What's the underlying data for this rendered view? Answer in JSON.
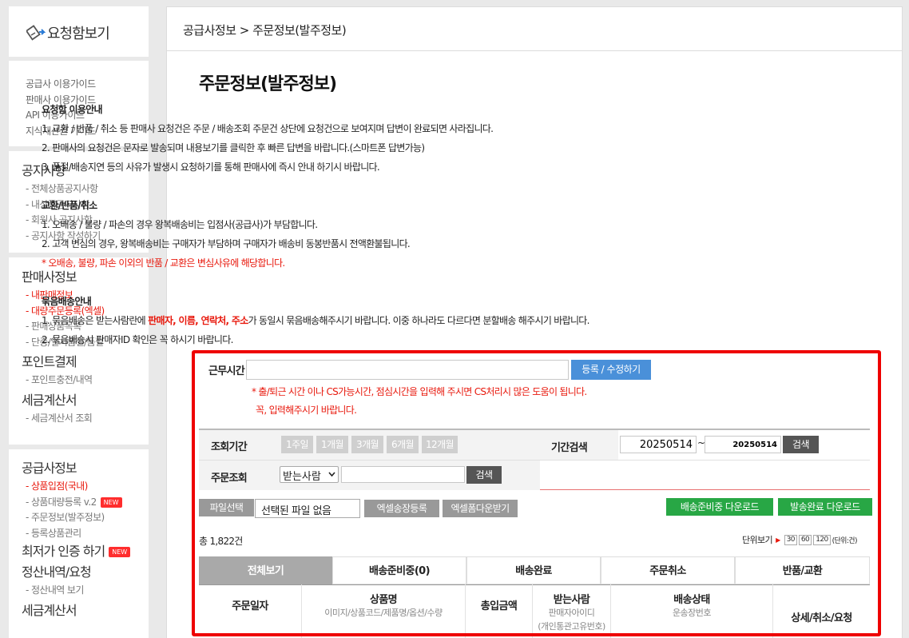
{
  "sidebar": {
    "logo_text": "요청함보기",
    "guides": [
      "공급사 이용가이드",
      "판매사 이용가이드",
      "API 이용가이드",
      "지식재산권 가이드"
    ],
    "notice": {
      "title": "공지사항",
      "items": [
        "- 전체상품공지사항",
        "- 내상품공지사항",
        "- 회원사 공지사항",
        "- 공지사항 작성하기"
      ]
    },
    "seller": {
      "title": "판매사정보",
      "items": [
        "- 내판매정보",
        "- 대량주문등록(엑셀)",
        "- 판매상품목록",
        "- 단종/일시품절/품절"
      ],
      "point_title": "포인트결제",
      "point_items": [
        "- 포인트충전/내역"
      ],
      "tax_title": "세금계산서",
      "tax_items": [
        "- 세금계산서 조회"
      ]
    },
    "supplier": {
      "title": "공급사정보",
      "items": [
        "- 상품입점(국내)",
        "- 상품대량등록 v.2",
        "- 주문정보(발주정보)",
        "- 등록상품관리"
      ],
      "badge_new": "NEW",
      "lowest_title": "최저가 인증 하기",
      "settle_title": "정산내역/요청",
      "settle_items": [
        "- 정산내역 보기"
      ],
      "tax_title": "세금계산서"
    }
  },
  "main": {
    "breadcrumb": "공급사정보 > 주문정보(발주정보)",
    "page_title": "주문정보(발주정보)",
    "guide1": {
      "title": "요청함 이용안내",
      "lines": [
        "1. 교환 / 반품 / 취소 등 판매사 요청건은 주문 / 배송조회 주문건 상단에 요청건으로 보여지며 답변이 완료되면 사라집니다.",
        "2. 판매사의 요청건은 문자로 발송되며 내용보기를 클릭한 후 빠른 답변을 바랍니다.(스마트폰 답변가능)",
        "3. 품절/배송지연 등의 사유가 발생시 요청하기를 통해 판매사에 즉시 안내 하기시 바랍니다."
      ]
    },
    "guide2": {
      "title": "교환/반품/취소",
      "lines": [
        "1. 오배송 / 불량 / 파손의 경우 왕복배송비는 입점사(공급사)가 부담합니다.",
        "2. 고객 변심의 경우, 왕복배송비는 구매자가 부담하며 구매자가 배송비 동봉반품시 전액환불됩니다."
      ],
      "red_note": "* 오배송, 불량, 파손 이외의 반품 / 교환은 변심사유에 해당합니다."
    },
    "guide3": {
      "title": "묶음배송안내",
      "line1_prefix": "1. 묶음배송은 받는사람란에 ",
      "line1_red": "판매자, 이름, 연락처, 주소",
      "line1_suffix": "가 동일시 묶음배송해주시기 바랍니다. 이중 하나라도 다르다면 분할배송 해주시기 바랍니다.",
      "line2": "2. 묶음배송시 판매자ID 확인은 꼭 하시기 바랍니다."
    },
    "work_hours": {
      "label": "근무시간",
      "value": "",
      "button": "등록 / 수정하기",
      "note1": "* 출/퇴근 시간 이나 CS가능시간, 점심시간을 입력해 주시면 CS처리시 많은 도움이 됩니다.",
      "note2": "꼭, 입력해주시기 바랍니다."
    },
    "search": {
      "period_label": "조회기간",
      "periods": [
        "1주일",
        "1개월",
        "3개월",
        "6개월",
        "12개월"
      ],
      "range_label": "기간검색",
      "date_from": "20250514",
      "tilde": "~",
      "date_to": "20250514",
      "search_button": "검색",
      "order_label": "주문조회",
      "order_select": "받는사람",
      "order_input": "",
      "order_search_button": "검색"
    },
    "file": {
      "select_label": "파일선택",
      "file_status": "선택된 파일 없음",
      "excel_register": "엑셀송장등록",
      "excel_download": "엑셀폼다운받기",
      "ready_download": "배송준비중 다운로드",
      "done_download": "발송완료 다운로드"
    },
    "summary": {
      "total": "총 1,822건",
      "unit_label": "단위보기",
      "units": [
        "30",
        "60",
        "120"
      ],
      "unit_suffix": "(단위:건)"
    },
    "tabs": [
      "전체보기",
      "배송준비중(0)",
      "배송완료",
      "주문취소",
      "반품/교환"
    ],
    "columns": [
      {
        "title": "주문일자",
        "sub": ""
      },
      {
        "title": "상품명",
        "sub": "이미지/상품코드/제품명/옵션/수량"
      },
      {
        "title": "총입금액",
        "sub": ""
      },
      {
        "title": "받는사람",
        "sub": "판매자아이디",
        "sub2": "(개인통관고유번호)"
      },
      {
        "title": "배송상태",
        "sub": "운송장번호"
      },
      {
        "title": "상세/취소/요청",
        "sub": ""
      }
    ]
  },
  "colors": {
    "accent_red": "#e8180c",
    "highlight_border": "#ee0000",
    "button_blue": "#4a90d9",
    "button_green": "#28a745",
    "tab_active": "#a9a9a9"
  }
}
